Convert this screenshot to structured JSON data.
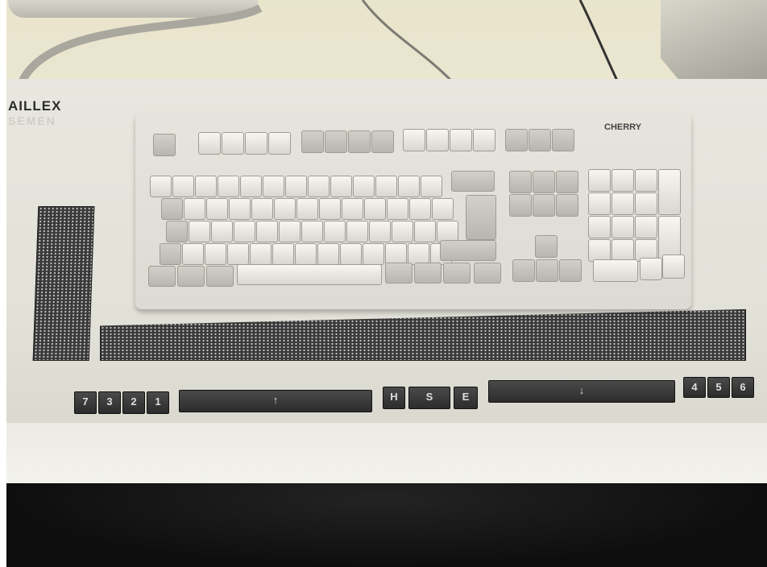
{
  "scene": {
    "description_labels": {
      "brand_line1": "AILLEX",
      "brand_line2": "SEMEN"
    },
    "keyboard_brand": "CHERRY",
    "front_keys_left": [
      "7",
      "3",
      "2",
      "1"
    ],
    "front_keys_middle": [
      "H",
      "S",
      "E"
    ],
    "front_keys_right": [
      "4",
      "5",
      "6"
    ],
    "arrow_up": "↑",
    "arrow_down": "↓"
  }
}
